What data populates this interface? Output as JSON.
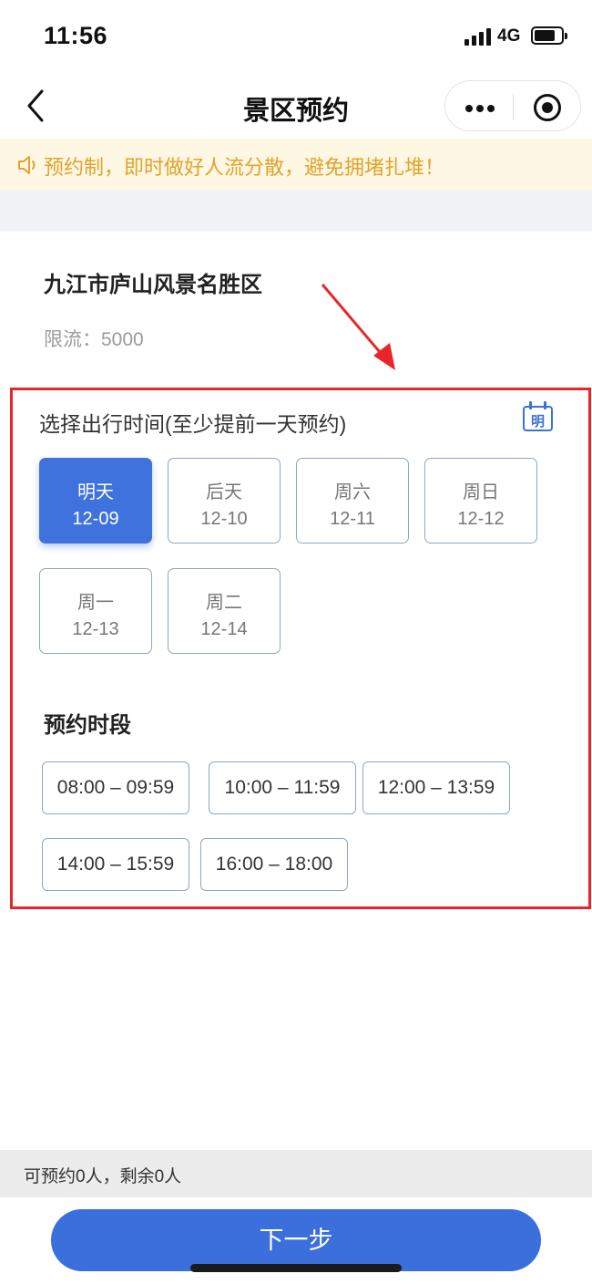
{
  "status_bar": {
    "time": "11:56",
    "network": "4G"
  },
  "nav": {
    "title": "景区预约"
  },
  "notice": {
    "text": "预约制，即时做好人流分散，避免拥堵扎堆！",
    "color": "#e1a32a"
  },
  "scenic": {
    "name": "九江市庐山风景名胜区",
    "limit": "限流：5000"
  },
  "date_section": {
    "heading": "选择出行时间(至少提前一天预约)",
    "calendar_char": "明",
    "dates": [
      {
        "weekday": "明天",
        "date": "12-09",
        "selected": true
      },
      {
        "weekday": "后天",
        "date": "12-10",
        "selected": false
      },
      {
        "weekday": "周六",
        "date": "12-11",
        "selected": false
      },
      {
        "weekday": "周日",
        "date": "12-12",
        "selected": false
      },
      {
        "weekday": "周一",
        "date": "12-13",
        "selected": false
      },
      {
        "weekday": "周二",
        "date": "12-14",
        "selected": false
      }
    ]
  },
  "slot_section": {
    "heading": "预约时段",
    "slots": [
      "08:00 – 09:59",
      "10:00 – 11:59",
      "12:00 – 13:59",
      "14:00 – 15:59",
      "16:00 – 18:00"
    ]
  },
  "footer": {
    "capacity": "可预约0人，剩余0人",
    "next_label": "下一步"
  },
  "colors": {
    "accent": "#3f72dc",
    "highlight": "#e8262a",
    "notice_bg": "#fdf7e3"
  }
}
